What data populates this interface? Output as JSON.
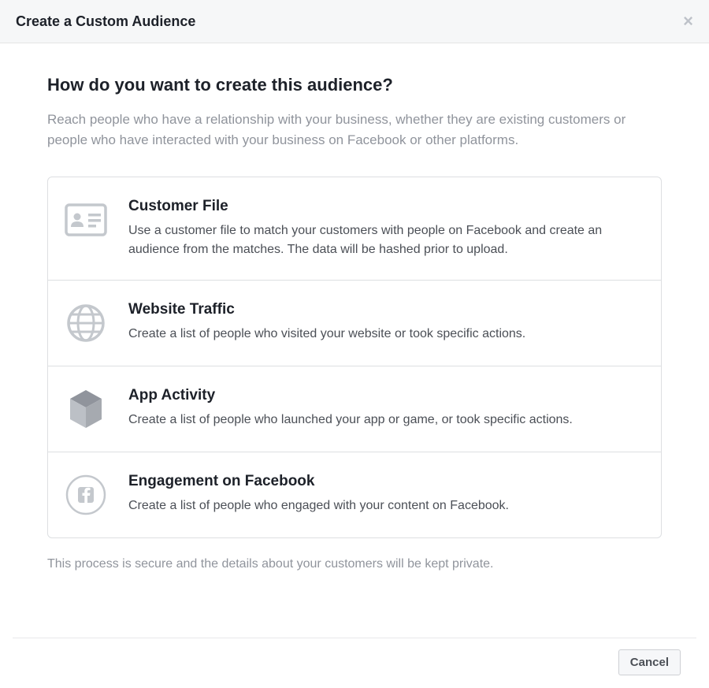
{
  "header": {
    "title": "Create a Custom Audience"
  },
  "body": {
    "heading": "How do you want to create this audience?",
    "intro": "Reach people who have a relationship with your business, whether they are existing customers or people who have interacted with your business on Facebook or other platforms.",
    "options": [
      {
        "title": "Customer File",
        "desc": "Use a customer file to match your customers with people on Facebook and create an audience from the matches. The data will be hashed prior to upload."
      },
      {
        "title": "Website Traffic",
        "desc": "Create a list of people who visited your website or took specific actions."
      },
      {
        "title": "App Activity",
        "desc": "Create a list of people who launched your app or game, or took specific actions."
      },
      {
        "title": "Engagement on Facebook",
        "desc": "Create a list of people who engaged with your content on Facebook."
      }
    ],
    "privacy_note": "This process is secure and the details about your customers will be kept private."
  },
  "footer": {
    "cancel_label": "Cancel"
  }
}
